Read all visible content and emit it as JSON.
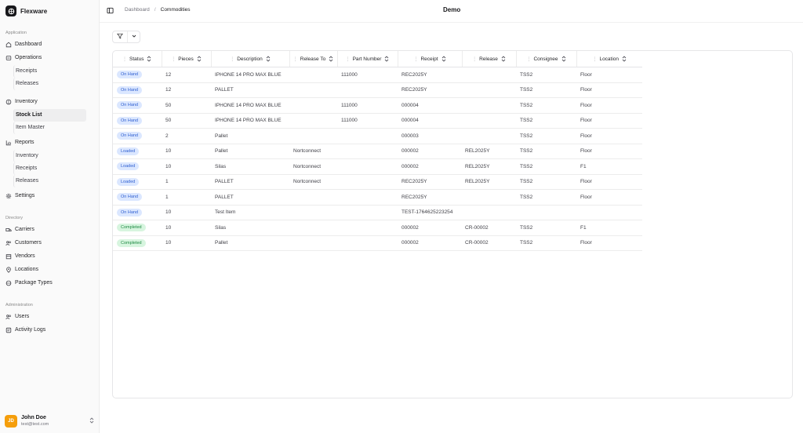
{
  "app": {
    "name": "Flexware",
    "workspace": "Demo"
  },
  "breadcrumb": {
    "parent": "Dashboard",
    "separator": "/",
    "current": "Commodities"
  },
  "sidebar": {
    "application_label": "Application",
    "dashboard": "Dashboard",
    "operations": {
      "label": "Operations",
      "children": [
        "Receipts",
        "Releases"
      ]
    },
    "inventory": {
      "label": "Inventory",
      "children": [
        "Stock List",
        "Item Master"
      ]
    },
    "reports": {
      "label": "Reports",
      "children": [
        "Inventory",
        "Receipts",
        "Releases"
      ]
    },
    "settings": "Settings",
    "directory_label": "Directory",
    "directory": [
      "Carriers",
      "Customers",
      "Vendors",
      "Locations",
      "Package Types"
    ],
    "administration_label": "Administration",
    "administration": [
      "Users",
      "Activity Logs"
    ]
  },
  "user": {
    "initials": "JD",
    "name": "John Doe",
    "email": "test@test.com"
  },
  "table": {
    "columns": [
      "Status",
      "Pieces",
      "Description",
      "Release To",
      "Part Number",
      "Receipt",
      "Release",
      "Consignee",
      "Location"
    ],
    "rows": [
      {
        "status": "On Hand",
        "status_color": "blue",
        "pieces": "12",
        "description": "IPHONE 14 PRO MAX BLUE",
        "release_to": "",
        "part_number": "111000",
        "receipt": "REC2025Y",
        "release": "",
        "consignee": "TSS2",
        "location": "Floor"
      },
      {
        "status": "On Hand",
        "status_color": "blue",
        "pieces": "12",
        "description": "PALLET",
        "release_to": "",
        "part_number": "",
        "receipt": "REC2025Y",
        "release": "",
        "consignee": "TSS2",
        "location": "Floor"
      },
      {
        "status": "On Hand",
        "status_color": "blue",
        "pieces": "50",
        "description": "IPHONE 14 PRO MAX BLUE",
        "release_to": "",
        "part_number": "111000",
        "receipt": "000004",
        "release": "",
        "consignee": "TSS2",
        "location": "Floor"
      },
      {
        "status": "On Hand",
        "status_color": "blue",
        "pieces": "50",
        "description": "IPHONE 14 PRO MAX BLUE",
        "release_to": "",
        "part_number": "111000",
        "receipt": "000004",
        "release": "",
        "consignee": "TSS2",
        "location": "Floor"
      },
      {
        "status": "On Hand",
        "status_color": "blue",
        "pieces": "2",
        "description": "Pallet",
        "release_to": "",
        "part_number": "",
        "receipt": "000003",
        "release": "",
        "consignee": "TSS2",
        "location": "Floor"
      },
      {
        "status": "Loaded",
        "status_color": "blue",
        "pieces": "10",
        "description": "Pallet",
        "release_to": "Nortconnect",
        "part_number": "",
        "receipt": "000002",
        "release": "REL2025Y",
        "consignee": "TSS2",
        "location": "Floor"
      },
      {
        "status": "Loaded",
        "status_color": "blue",
        "pieces": "10",
        "description": "Silas",
        "release_to": "Nortconnect",
        "part_number": "",
        "receipt": "000002",
        "release": "REL2025Y",
        "consignee": "TSS2",
        "location": "F1"
      },
      {
        "status": "Loaded",
        "status_color": "blue",
        "pieces": "1",
        "description": "PALLET",
        "release_to": "Nortconnect",
        "part_number": "",
        "receipt": "REC2025Y",
        "release": "REL2025Y",
        "consignee": "TSS2",
        "location": "Floor"
      },
      {
        "status": "On Hand",
        "status_color": "blue",
        "pieces": "1",
        "description": "PALLET",
        "release_to": "",
        "part_number": "",
        "receipt": "REC2025Y",
        "release": "",
        "consignee": "TSS2",
        "location": "Floor"
      },
      {
        "status": "On Hand",
        "status_color": "blue",
        "pieces": "10",
        "description": "Test Item",
        "release_to": "",
        "part_number": "",
        "receipt": "TEST-1764625223254",
        "release": "",
        "consignee": "",
        "location": ""
      },
      {
        "status": "Completed",
        "status_color": "green",
        "pieces": "10",
        "description": "Silas",
        "release_to": "",
        "part_number": "",
        "receipt": "000002",
        "release": "CR-00002",
        "consignee": "TSS2",
        "location": "F1"
      },
      {
        "status": "Completed",
        "status_color": "green",
        "pieces": "10",
        "description": "Pallet",
        "release_to": "",
        "part_number": "",
        "receipt": "000002",
        "release": "CR-00002",
        "consignee": "TSS2",
        "location": "Floor"
      }
    ]
  }
}
